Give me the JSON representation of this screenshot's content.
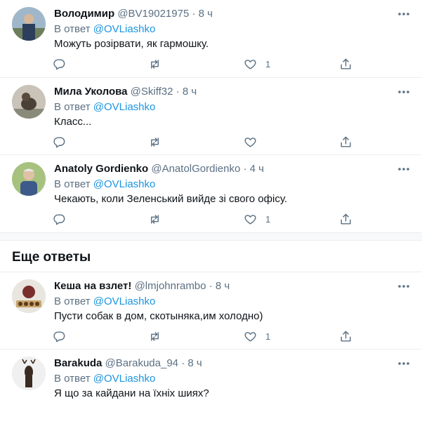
{
  "more_replies_heading": "Еще ответы",
  "reply_prefix": "В ответ",
  "dot": "·",
  "colors": {
    "link": "#1b95e0",
    "secondary": "#5b7083",
    "text": "#0f1419",
    "separator": "#ebeef0"
  },
  "icons": {
    "reply": "reply-icon",
    "retweet": "retweet-icon",
    "like": "heart-icon",
    "share": "share-icon",
    "more": "more-icon"
  },
  "tweets": [
    {
      "name": "Володимир",
      "handle": "@BV19021975",
      "time": "8 ч",
      "reply_to": "@OVLiashko",
      "text": "Можуть розірвати, як гармошку.",
      "likes": "1"
    },
    {
      "name": "Мила Уколова",
      "handle": "@Skiff32",
      "time": "8 ч",
      "reply_to": "@OVLiashko",
      "text": "Класс...",
      "likes": ""
    },
    {
      "name": "Anatoly Gordienko",
      "handle": "@AnatolGordienko",
      "time": "4 ч",
      "reply_to": "@OVLiashko",
      "text": "Чекають, коли Зеленський вийде зі свого офісу.",
      "likes": "1"
    },
    {
      "name": "Кеша на взлет!",
      "handle": "@lmjohnrambo",
      "time": "8 ч",
      "reply_to": "@OVLiashko",
      "text": "Пусти собак в дом, скотыняка,им холодно)",
      "likes": "1"
    },
    {
      "name": "Barakuda",
      "handle": "@Barakuda_94",
      "time": "8 ч",
      "reply_to": "@OVLiashko",
      "text": "Я що за кайдани на їхніх шиях?",
      "likes": ""
    }
  ]
}
